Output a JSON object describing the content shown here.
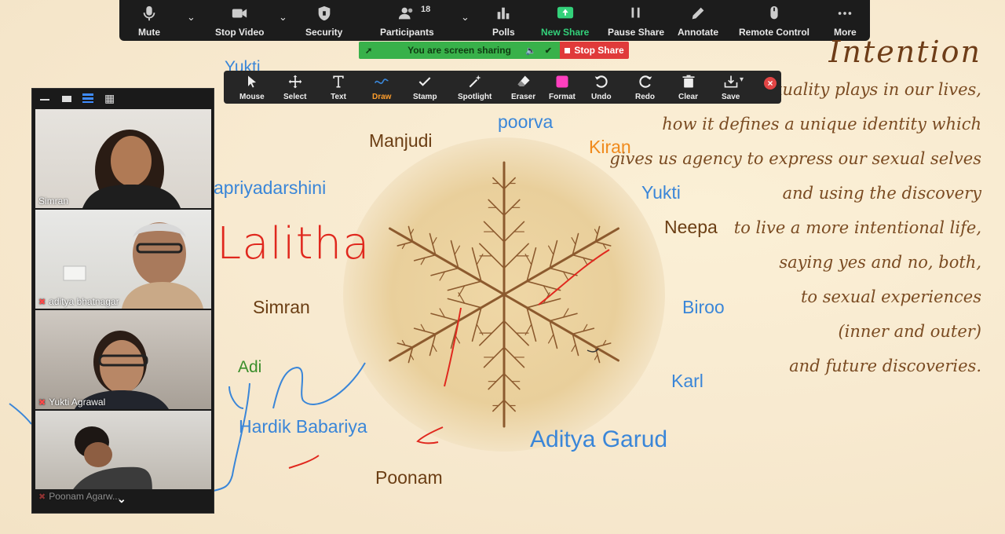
{
  "toolbar": {
    "mute": "Mute",
    "stop_video": "Stop Video",
    "security": "Security",
    "participants": "Participants",
    "participants_count": "18",
    "polls": "Polls",
    "new_share": "New Share",
    "pause_share": "Pause Share",
    "annotate": "Annotate",
    "remote_control": "Remote Control",
    "more": "More"
  },
  "share_bar": {
    "status": "You are screen sharing",
    "stop_label": "Stop Share"
  },
  "annotation_tools": [
    {
      "label": "Mouse",
      "icon": "cursor-icon"
    },
    {
      "label": "Select",
      "icon": "move-icon"
    },
    {
      "label": "Text",
      "icon": "text-icon"
    },
    {
      "label": "Draw",
      "icon": "draw-icon",
      "active": true
    },
    {
      "label": "Stamp",
      "icon": "check-icon"
    },
    {
      "label": "Spotlight",
      "icon": "wand-icon"
    },
    {
      "label": "Eraser",
      "icon": "eraser-icon"
    },
    {
      "label": "Format",
      "icon": "format-swatch-icon"
    },
    {
      "label": "Undo",
      "icon": "undo-icon"
    },
    {
      "label": "Redo",
      "icon": "redo-icon"
    },
    {
      "label": "Clear",
      "icon": "trash-icon"
    },
    {
      "label": "Save",
      "icon": "save-icon"
    }
  ],
  "participants": [
    {
      "name": "Simran",
      "muted": false
    },
    {
      "name": "aditya bhatnagar",
      "muted": true
    },
    {
      "name": "Yukti Agrawal",
      "muted": true
    },
    {
      "name": "Poonam Agarw...",
      "muted": true
    }
  ],
  "slide": {
    "title": "Intention",
    "lines": [
      "xuality plays in our lives,",
      "how it defines a unique identity which",
      "gives us agency to express our sexual selves",
      "and using the discovery",
      "to live a more intentional life,",
      "saying yes and no, both,",
      "to sexual experiences",
      "(inner and outer)",
      "and future discoveries."
    ]
  },
  "annotations": {
    "yukti_top": "Yukti",
    "poorva": "poorva",
    "manjudi": "Manjudi",
    "kiran": "Kiran",
    "apriyadarshini": "apriyadarshini",
    "yukti": "Yukti",
    "neepa": "Neepa",
    "lalitha": "Lalitha",
    "simran": "Simran",
    "biroo": "Biroo",
    "adi": "Adi",
    "karl": "Karl",
    "hardik": "Hardik Babariya",
    "aditya_garud": "Aditya Garud",
    "poonam": "Poonam"
  },
  "colors": {
    "share_green": "#38b14a",
    "stop_red": "#e03a3a",
    "draw_active": "#ff9e2c",
    "annotation_blue": "#3a86d8",
    "annotation_brown": "#6b3e14",
    "annotation_red": "#e0281e"
  }
}
